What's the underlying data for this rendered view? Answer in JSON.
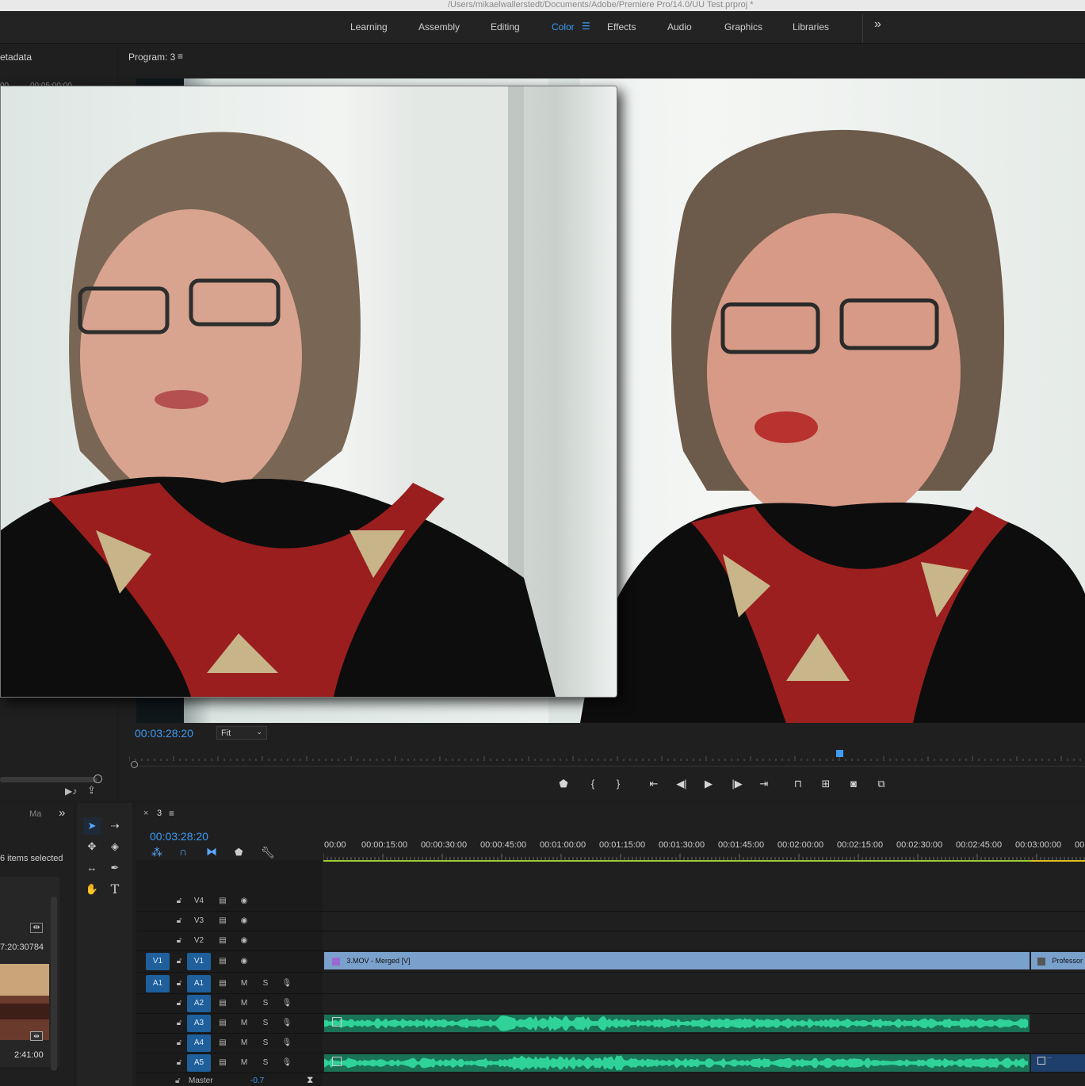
{
  "window": {
    "path": "/Users/mikaelwallerstedt/Documents/Adobe/Premiere Pro/14.0/UU Test.prproj *"
  },
  "workspaces": {
    "tabs": [
      {
        "label": "Learning"
      },
      {
        "label": "Assembly"
      },
      {
        "label": "Editing"
      },
      {
        "label": "Color"
      },
      {
        "label": "Effects"
      },
      {
        "label": "Audio"
      },
      {
        "label": "Graphics"
      },
      {
        "label": "Libraries"
      }
    ],
    "active": "Color",
    "overflow": "»"
  },
  "left_top_panel": {
    "title": "etadata",
    "time_a": "00",
    "time_b": "00:05:00:00"
  },
  "program": {
    "title": "Program: 3",
    "menu": "≡",
    "timecode": "00:03:28:20",
    "zoom": "Fit",
    "playhead_fraction": 0.74
  },
  "project": {
    "tab": "Ma",
    "overflow": "»",
    "selection": "6 items selected",
    "clip_timecode": "7:20:30784",
    "thumb_duration": "2:41:00"
  },
  "timeline": {
    "close": "×",
    "sequence": "3",
    "menu": "≡",
    "timecode": "00:03:28:20",
    "ruler": [
      "00:00",
      "00:00:15:00",
      "00:00:30:00",
      "00:00:45:00",
      "00:01:00:00",
      "00:01:15:00",
      "00:01:30:00",
      "00:01:45:00",
      "00:02:00:00",
      "00:02:15:00",
      "00:02:30:00",
      "00:02:45:00",
      "00:03:00:00",
      "00"
    ],
    "video_tracks": [
      {
        "name": "V4"
      },
      {
        "name": "V3"
      },
      {
        "name": "V2"
      },
      {
        "name": "V1",
        "source": "V1"
      }
    ],
    "audio_tracks": [
      {
        "name": "A1",
        "source": "A1"
      },
      {
        "name": "A2"
      },
      {
        "name": "A3"
      },
      {
        "name": "A4"
      },
      {
        "name": "A5"
      }
    ],
    "mute": "M",
    "solo": "S",
    "master": {
      "label": "Master",
      "value": "-0.7"
    },
    "clips": {
      "v1_main": "3.MOV - Merged [V]",
      "v1_next": "Professor",
      "a5_next": "..."
    }
  },
  "colors": {
    "accent": "#3d9bf5",
    "video_clip": "#7aa0cc",
    "audio_clip": "#1a7356",
    "waveform": "#2fd39a"
  }
}
